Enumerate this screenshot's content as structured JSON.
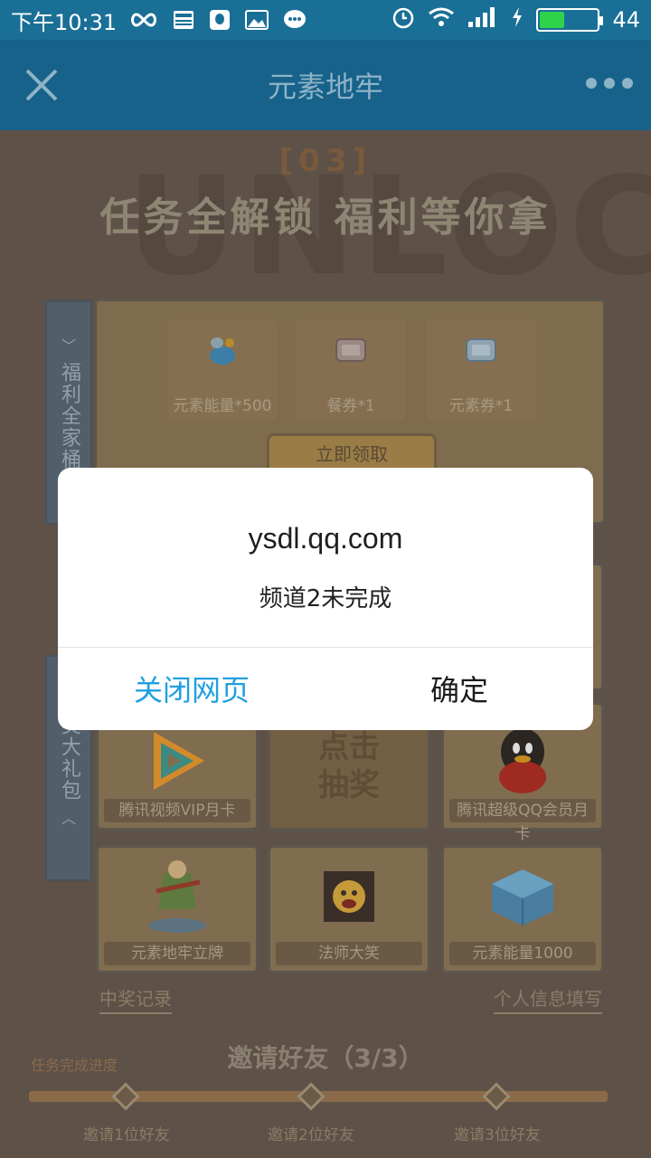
{
  "status_bar": {
    "time": "下午10:31",
    "battery": "44",
    "battery_level_percent": 44,
    "icons": [
      "infinity-icon",
      "news-icon",
      "qq-icon",
      "image-icon",
      "chat-icon",
      "alarm-icon",
      "wifi-icon",
      "signal-icon",
      "charging-icon",
      "battery-icon"
    ]
  },
  "nav": {
    "title": "元素地牢",
    "close_icon": "close-icon",
    "more_icon": "more-icon"
  },
  "page": {
    "bg_word": "UNLOCK",
    "section_num": "[03]",
    "headline": "任务全解锁  福利等你拿",
    "family_tab": "福利全家桶",
    "gifts": [
      {
        "label": "元素能量*500",
        "icon": "energy-bag-icon"
      },
      {
        "label": "餐券*1",
        "icon": "meal-ticket-icon"
      },
      {
        "label": "元素券*1",
        "icon": "element-ticket-icon"
      }
    ],
    "claim_button": "立即领取",
    "lottery_tab": "抽奖大礼包",
    "lottery_center": [
      "点击",
      "抽奖"
    ],
    "prizes": [
      {
        "label": "腾讯视频VIP月卡",
        "icon": "tencent-video-icon"
      },
      {
        "label": "腾讯超级QQ会员月卡",
        "icon": "qq-penguin-icon"
      },
      {
        "label": "元素地牢立牌",
        "icon": "character-stand-icon"
      },
      {
        "label": "法师大笑",
        "icon": "mage-laugh-icon"
      },
      {
        "label": "元素能量1000",
        "icon": "energy-crystal-icon"
      }
    ],
    "win_record": "中奖记录",
    "personal_info": "个人信息填写",
    "invite_title": "邀请好友（3/3）",
    "progress_label": "任务完成进度",
    "milestones": [
      "邀请1位好友",
      "邀请2位好友",
      "邀请3位好友"
    ]
  },
  "dialog": {
    "host": "ysdl.qq.com",
    "message": "频道2未完成",
    "close_page": "关闭网页",
    "confirm": "确定"
  },
  "colors": {
    "status_bar": "#1a6f96",
    "nav_bar": "#16628a",
    "dialog_link": "#20a0e0"
  }
}
